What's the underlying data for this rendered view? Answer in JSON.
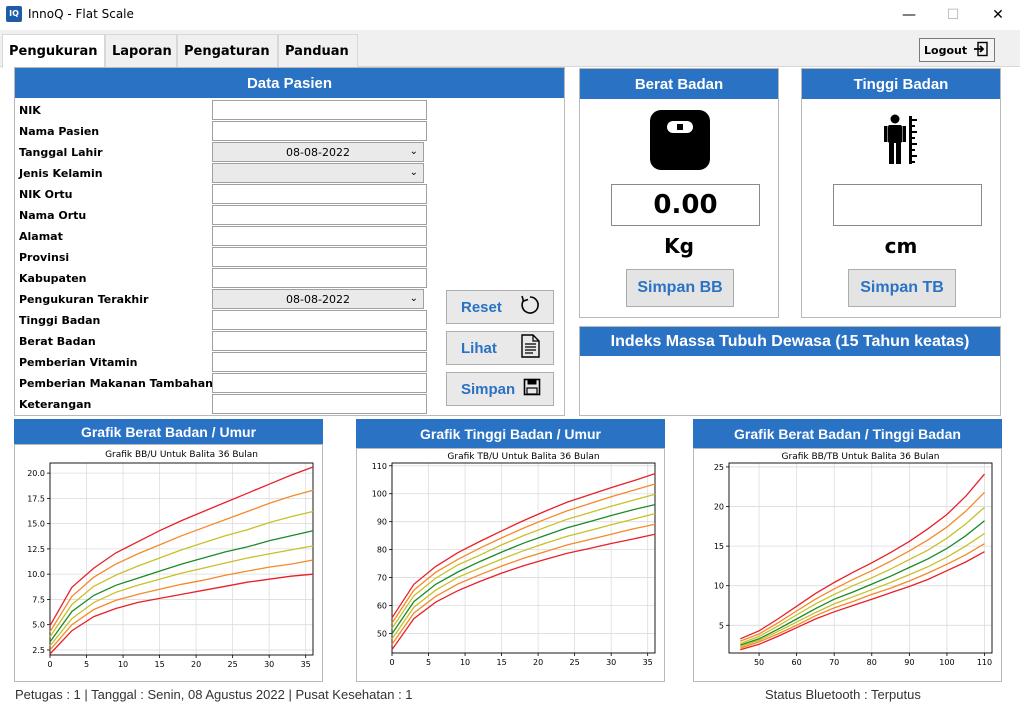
{
  "window": {
    "title": "InnoQ - Flat Scale",
    "icon_text": "IQ",
    "minimize": "—",
    "maximize": "☐",
    "close": "✕"
  },
  "tabs": [
    {
      "label": "Pengukuran",
      "active": true
    },
    {
      "label": "Laporan",
      "active": false
    },
    {
      "label": "Pengaturan",
      "active": false
    },
    {
      "label": "Panduan",
      "active": false
    }
  ],
  "logout_label": "Logout",
  "patient": {
    "title": "Data Pasien",
    "fields": {
      "nik": "NIK",
      "nama_pasien": "Nama Pasien",
      "tanggal_lahir": "Tanggal Lahir",
      "jenis_kelamin": "Jenis Kelamin",
      "nik_ortu": "NIK Ortu",
      "nama_ortu": "Nama Ortu",
      "alamat": "Alamat",
      "provinsi": "Provinsi",
      "kabupaten": "Kabupaten",
      "pengukuran_terakhir": "Pengukuran Terakhir",
      "tinggi_badan": "Tinggi Badan",
      "berat_badan": "Berat Badan",
      "pemberian_vitamin": "Pemberian Vitamin",
      "pmt": "Pemberian Makanan Tambahan",
      "keterangan": "Keterangan"
    },
    "tanggal_lahir_value": "08-08-2022",
    "pengukuran_terakhir_value": "08-08-2022",
    "buttons": {
      "reset": "Reset",
      "lihat": "Lihat",
      "simpan": "Simpan"
    }
  },
  "weight": {
    "title": "Berat Badan",
    "value": "0.00",
    "unit": "Kg",
    "save": "Simpan BB"
  },
  "height": {
    "title": "Tinggi Badan",
    "value": "",
    "unit": "cm",
    "save": "Simpan TB"
  },
  "bmi": {
    "title": "Indeks Massa Tubuh Dewasa (15 Tahun keatas)"
  },
  "colors": {
    "header_blue": "#2a72c4",
    "red": "#e8202a",
    "orange": "#f5892a",
    "yellow": "#c8c02a",
    "green": "#1a8a2a"
  },
  "charts": {
    "bbu_panel": "Grafik Berat Badan / Umur",
    "tbu_panel": "Grafik Tinggi Badan / Umur",
    "bbtb_panel": "Grafik Berat Badan / Tinggi Badan"
  },
  "chart_data": [
    {
      "type": "line",
      "title": "Grafik BB/U Untuk Balita 36 Bulan",
      "x": [
        0,
        3,
        6,
        9,
        12,
        15,
        18,
        21,
        24,
        27,
        30,
        33,
        36
      ],
      "xlim": [
        0,
        36
      ],
      "ylim": [
        2,
        21
      ],
      "xticks": [
        0,
        5,
        10,
        15,
        20,
        25,
        30,
        35
      ],
      "yticks": [
        2.5,
        5.0,
        7.5,
        10.0,
        12.5,
        15.0,
        17.5,
        20.0
      ],
      "grid": true,
      "series": [
        {
          "color": "#e8202a",
          "values": [
            2.1,
            4.4,
            5.8,
            6.6,
            7.2,
            7.6,
            8.0,
            8.4,
            8.8,
            9.2,
            9.5,
            9.8,
            10.0
          ]
        },
        {
          "color": "#f5892a",
          "values": [
            2.5,
            5.0,
            6.5,
            7.4,
            8.0,
            8.5,
            9.0,
            9.4,
            9.9,
            10.3,
            10.7,
            11.0,
            11.4
          ]
        },
        {
          "color": "#c8c02a",
          "values": [
            2.9,
            5.6,
            7.2,
            8.2,
            8.9,
            9.5,
            10.1,
            10.6,
            11.1,
            11.6,
            12.0,
            12.4,
            12.8
          ]
        },
        {
          "color": "#1a8a2a",
          "values": [
            3.3,
            6.3,
            7.9,
            8.9,
            9.6,
            10.3,
            11.0,
            11.6,
            12.2,
            12.7,
            13.3,
            13.8,
            14.3
          ]
        },
        {
          "color": "#c8c02a",
          "values": [
            3.8,
            7.0,
            8.8,
            9.9,
            10.8,
            11.6,
            12.4,
            13.1,
            13.8,
            14.4,
            15.1,
            15.7,
            16.2
          ]
        },
        {
          "color": "#f5892a",
          "values": [
            4.3,
            7.8,
            9.7,
            11.0,
            12.0,
            12.9,
            13.8,
            14.6,
            15.4,
            16.2,
            17.0,
            17.7,
            18.3
          ]
        },
        {
          "color": "#e8202a",
          "values": [
            4.9,
            8.7,
            10.6,
            12.1,
            13.2,
            14.3,
            15.3,
            16.2,
            17.1,
            18.0,
            18.9,
            19.8,
            20.6
          ]
        }
      ]
    },
    {
      "type": "line",
      "title": "Grafik TB/U Untuk Balita 36 Bulan",
      "x": [
        0,
        3,
        6,
        9,
        12,
        15,
        18,
        21,
        24,
        27,
        30,
        33,
        36
      ],
      "xlim": [
        0,
        36
      ],
      "ylim": [
        43,
        111
      ],
      "xticks": [
        0,
        5,
        10,
        15,
        20,
        25,
        30,
        35
      ],
      "yticks": [
        50,
        60,
        70,
        80,
        90,
        100,
        110
      ],
      "grid": true,
      "series": [
        {
          "color": "#e8202a",
          "values": [
            44.2,
            55.3,
            61.2,
            65.3,
            68.6,
            71.6,
            74.2,
            76.5,
            78.7,
            80.4,
            82.2,
            83.8,
            85.5
          ]
        },
        {
          "color": "#f5892a",
          "values": [
            46.1,
            57.3,
            63.3,
            67.7,
            71.0,
            74.1,
            76.9,
            79.3,
            81.7,
            83.6,
            85.5,
            87.4,
            89.1
          ]
        },
        {
          "color": "#c8c02a",
          "values": [
            48.0,
            59.4,
            65.5,
            70.1,
            73.4,
            76.6,
            79.6,
            82.3,
            84.8,
            86.8,
            88.9,
            90.9,
            92.9
          ]
        },
        {
          "color": "#1a8a2a",
          "values": [
            49.9,
            61.4,
            67.6,
            72.0,
            75.7,
            79.1,
            82.3,
            85.1,
            87.8,
            90.0,
            92.2,
            94.3,
            96.1
          ]
        },
        {
          "color": "#c8c02a",
          "values": [
            51.8,
            63.5,
            69.8,
            74.5,
            78.0,
            81.7,
            85.0,
            88.0,
            90.9,
            93.2,
            95.5,
            97.7,
            99.8
          ]
        },
        {
          "color": "#f5892a",
          "values": [
            53.7,
            65.5,
            71.9,
            76.5,
            80.5,
            84.2,
            87.7,
            90.9,
            93.9,
            96.4,
            98.9,
            101.2,
            103.5
          ]
        },
        {
          "color": "#e8202a",
          "values": [
            55.6,
            67.6,
            74.0,
            78.9,
            82.9,
            86.7,
            90.4,
            93.8,
            97.0,
            99.6,
            102.2,
            104.6,
            107.2
          ]
        }
      ]
    },
    {
      "type": "line",
      "title": "Grafik BB/TB Untuk Balita 36 Bulan",
      "x": [
        45,
        50,
        55,
        60,
        65,
        70,
        75,
        80,
        85,
        90,
        95,
        100,
        105,
        110
      ],
      "xlim": [
        42,
        112
      ],
      "ylim": [
        1.5,
        25.5
      ],
      "xticks": [
        50,
        60,
        70,
        80,
        90,
        100,
        110
      ],
      "yticks": [
        5,
        10,
        15,
        20,
        25
      ],
      "grid": true,
      "series": [
        {
          "color": "#e8202a",
          "values": [
            1.9,
            2.6,
            3.6,
            4.7,
            5.8,
            6.7,
            7.5,
            8.3,
            9.1,
            9.9,
            10.8,
            11.9,
            13.0,
            14.3
          ]
        },
        {
          "color": "#f5892a",
          "values": [
            2.1,
            2.9,
            3.9,
            5.0,
            6.2,
            7.2,
            8.0,
            8.9,
            9.7,
            10.6,
            11.6,
            12.7,
            13.9,
            15.3
          ]
        },
        {
          "color": "#c8c02a",
          "values": [
            2.3,
            3.1,
            4.2,
            5.4,
            6.6,
            7.7,
            8.6,
            9.5,
            10.4,
            11.4,
            12.4,
            13.6,
            15.0,
            16.6
          ]
        },
        {
          "color": "#1a8a2a",
          "values": [
            2.5,
            3.3,
            4.5,
            5.8,
            7.1,
            8.3,
            9.2,
            10.2,
            11.2,
            12.3,
            13.4,
            14.7,
            16.3,
            18.2
          ]
        },
        {
          "color": "#c8c02a",
          "values": [
            2.7,
            3.6,
            4.9,
            6.3,
            7.7,
            8.9,
            10.0,
            11.0,
            12.1,
            13.3,
            14.5,
            16.0,
            17.8,
            19.9
          ]
        },
        {
          "color": "#f5892a",
          "values": [
            3.0,
            3.9,
            5.3,
            6.8,
            8.3,
            9.6,
            10.8,
            11.9,
            13.1,
            14.4,
            15.8,
            17.4,
            19.4,
            21.8
          ]
        },
        {
          "color": "#e8202a",
          "values": [
            3.3,
            4.3,
            5.8,
            7.4,
            9.0,
            10.4,
            11.7,
            12.9,
            14.2,
            15.6,
            17.2,
            19.0,
            21.3,
            24.1
          ]
        }
      ]
    }
  ],
  "status": {
    "left": "Petugas : 1 | Tanggal : Senin, 08 Agustus 2022 | Pusat Kesehatan : 1",
    "right": "Status Bluetooth : Terputus"
  }
}
